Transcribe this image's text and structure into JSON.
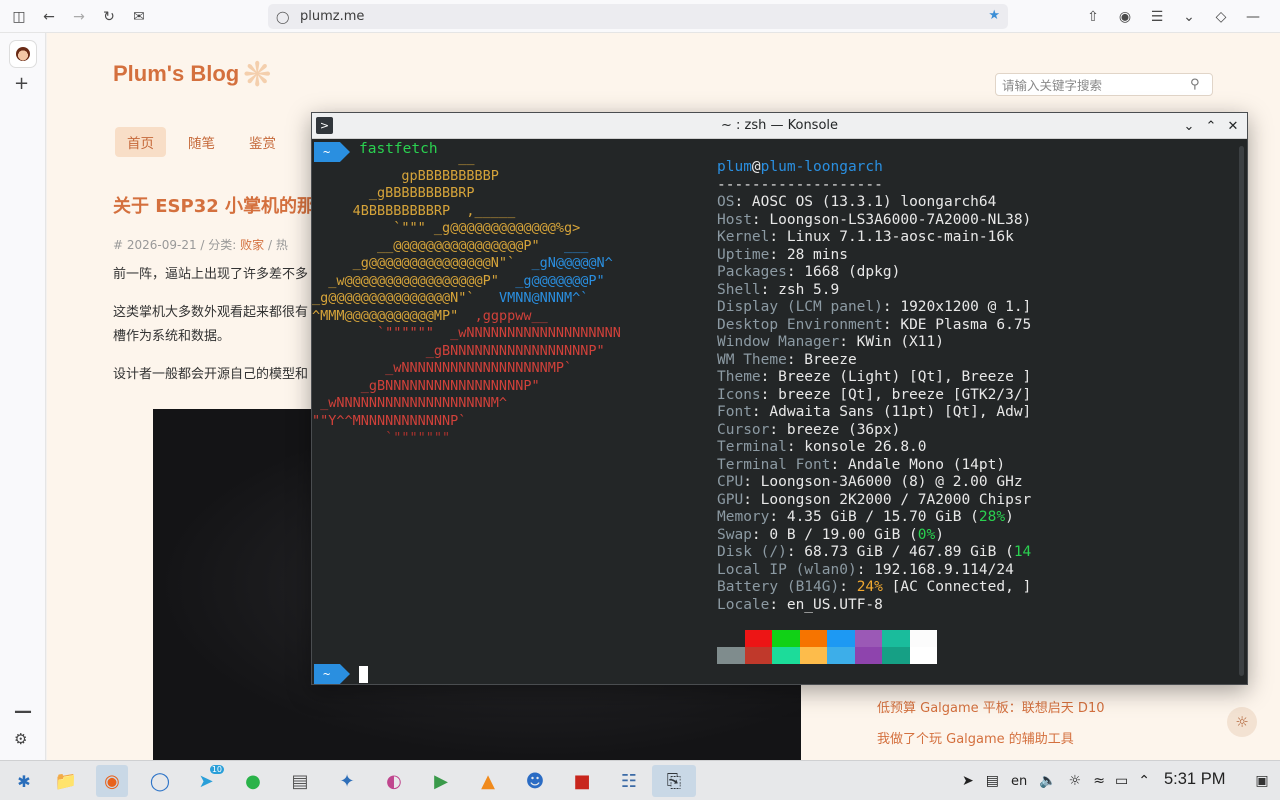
{
  "browser": {
    "url": "plumz.me",
    "icons": [
      "sidebar-toggle-icon",
      "back-icon",
      "forward-icon",
      "reload-icon",
      "extension-icon",
      "shield-icon",
      "bookmark-star-icon",
      "share-icon",
      "extensions-icon",
      "menu-icon",
      "chevron-down-icon",
      "pocket-icon",
      "minimize-icon"
    ]
  },
  "blog": {
    "title": "Plum's Blog",
    "search_placeholder": "请输入关键字搜索",
    "nav": [
      "首页",
      "随笔",
      "鉴赏"
    ],
    "post_title": "关于 ESP32 小掌机的那",
    "meta_prefix": "# 2026-09-21  /  分类: ",
    "meta_category": "败家",
    "meta_suffix": "  /  热",
    "paragraphs": [
      "前一阵，逼站上出现了许多差不多",
      "这类掌机大多数外观看起来都很有",
      "槽作为系统和数据。",
      "设计者一般都会开源自己的模型和"
    ],
    "side_links": [
      "低预算 Galgame 平板：联想启天 D10",
      "我做了个玩 Galgame 的辅助工具"
    ]
  },
  "konsole": {
    "title": "~ : zsh — Konsole",
    "prompt_symbol": "~",
    "command": "fastfetch",
    "user": "plum",
    "host": "plum-loongarch",
    "separator": "-------------------",
    "info": [
      {
        "k": "OS",
        "v": "AOSC OS (13.3.1) loongarch64"
      },
      {
        "k": "Host",
        "v": "Loongson-LS3A6000-7A2000-NL38)"
      },
      {
        "k": "Kernel",
        "v": "Linux 7.1.13-aosc-main-16k"
      },
      {
        "k": "Uptime",
        "v": "28 mins"
      },
      {
        "k": "Packages",
        "v": "1668 (dpkg)"
      },
      {
        "k": "Shell",
        "v": "zsh 5.9"
      },
      {
        "k": "Display (LCM panel)",
        "v": "1920x1200 @ 1.]"
      },
      {
        "k": "Desktop Environment",
        "v": "KDE Plasma 6.75"
      },
      {
        "k": "Window Manager",
        "v": "KWin (X11)"
      },
      {
        "k": "WM Theme",
        "v": "Breeze"
      },
      {
        "k": "Theme",
        "v": "Breeze (Light) [Qt], Breeze ]"
      },
      {
        "k": "Icons",
        "v": "breeze [Qt], breeze [GTK2/3/]"
      },
      {
        "k": "Font",
        "v": "Adwaita Sans (11pt) [Qt], Adw]"
      },
      {
        "k": "Cursor",
        "v": "breeze (36px)"
      },
      {
        "k": "Terminal",
        "v": "konsole 26.8.0"
      },
      {
        "k": "Terminal Font",
        "v": "Andale Mono (14pt)"
      },
      {
        "k": "CPU",
        "v": "Loongson-3A6000 (8) @ 2.00 GHz"
      },
      {
        "k": "GPU",
        "v": "Loongson 2K2000 / 7A2000 Chipsr"
      }
    ],
    "memory": {
      "k": "Memory",
      "v": "4.35 GiB / 15.70 GiB (",
      "pct": "28%",
      "end": ")"
    },
    "swap": {
      "k": "Swap",
      "v": "0 B / 19.00 GiB (",
      "pct": "0%",
      "end": ")"
    },
    "disk": {
      "k": "Disk (/)",
      "v": "68.73 GiB / 467.89 GiB (",
      "pct": "14"
    },
    "local_ip": {
      "k": "Local IP (wlan0)",
      "v": "192.168.9.114/24"
    },
    "battery": {
      "k": "Battery (B14G)",
      "pct": "24%",
      "v": " [AC Connected, ]"
    },
    "locale": {
      "k": "Locale",
      "v": "en_US.UTF-8"
    },
    "palette_top": [
      "#232627",
      "#ed1515",
      "#11d116",
      "#f67400",
      "#1d99f3",
      "#9b59b6",
      "#1abc9c",
      "#fcfcfc"
    ],
    "palette_bottom": [
      "#7f8c8d",
      "#c0392b",
      "#1cdc9a",
      "#fdbc4b",
      "#3daee9",
      "#8e44ad",
      "#16a085",
      "#ffffff"
    ]
  },
  "taskbar": {
    "apps": [
      "launcher-icon",
      "file-manager-icon",
      "firefox-icon",
      "chromium-icon",
      "telegram-icon",
      "wechat-icon",
      "text-editor-icon",
      "kdeconnect-icon",
      "color-picker-icon",
      "media-player-icon",
      "vlc-icon",
      "qq-icon",
      "filezilla-icon",
      "network-icon",
      "konsole-icon"
    ],
    "telegram_badge": "10",
    "lang": "en",
    "time": "5:31 PM"
  }
}
